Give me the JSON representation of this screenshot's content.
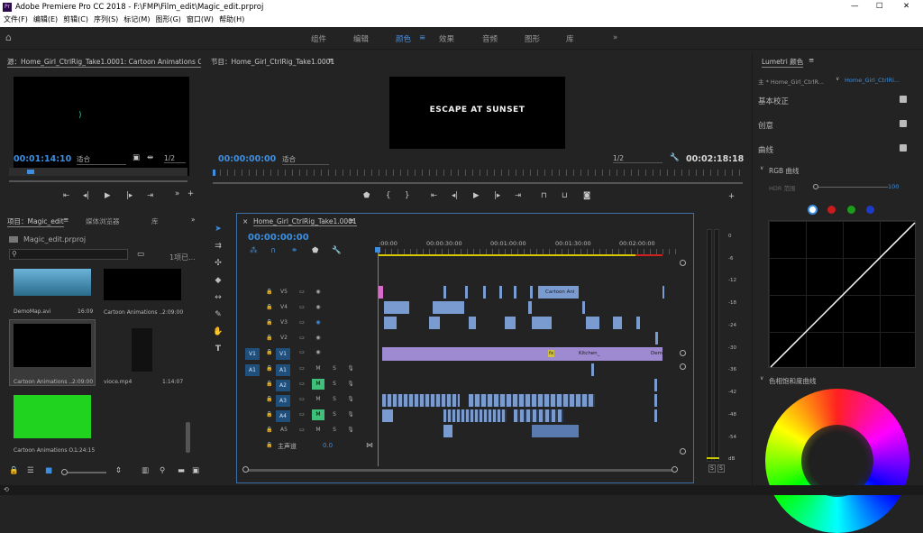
{
  "window": {
    "title": "Adobe Premiere Pro CC 2018 - F:\\FMP\\Film_edit\\Magic_edit.prproj",
    "minimize": "—",
    "maximize": "☐",
    "close": "✕"
  },
  "menu": [
    "文件(F)",
    "编辑(E)",
    "剪辑(C)",
    "序列(S)",
    "标记(M)",
    "图形(G)",
    "窗口(W)",
    "帮助(H)"
  ],
  "workspaces": {
    "items": [
      "组件",
      "编辑",
      "颜色",
      "效果",
      "音频",
      "图形",
      "库"
    ],
    "active": "颜色",
    "more": "»",
    "home": "⌂"
  },
  "source": {
    "title": "源：Home_Girl_CtrlRig_Take1.0001: Cartoon Animations O",
    "timecode": "00:01:14:10",
    "fit": "适合",
    "ratio": "1/2"
  },
  "program": {
    "title": "节目：Home_Girl_CtrlRig_Take1.0001",
    "video_text": "ESCAPE AT SUNSET",
    "timecode": "00:00:00:00",
    "fit": "适合",
    "ratio": "1/2",
    "duration": "00:02:18:18"
  },
  "project": {
    "title": "项目：Magic_edit",
    "tab_media": "媒体浏览器",
    "tab_lib": "库",
    "file": "Magic_edit.prproj",
    "count": "1项已...",
    "search_placeholder": "",
    "items": [
      {
        "name": "DemoMap.avi",
        "dur": "16:09",
        "thumb": "#4a8fb8"
      },
      {
        "name": "Cartoon Animations ...",
        "dur": "2:09:00",
        "thumb": "#000000"
      },
      {
        "name": "Cartoon Animations ...",
        "dur": "2:09:00",
        "thumb": "#000000"
      },
      {
        "name": "vioce.mp4",
        "dur": "1:14:07",
        "thumb": "#000000"
      },
      {
        "name": "Cartoon Animations O...",
        "dur": "1:24:15",
        "thumb": "#1fd31f"
      }
    ]
  },
  "timeline": {
    "title": "Home_Girl_CtrlRig_Take1.0001",
    "timecode": "00:00:00:00",
    "ruler": [
      ":00:00",
      "00:00:30:00",
      "00:01:00:00",
      "00:01:30:00",
      "00:02:00:00"
    ],
    "tracks": [
      "V5",
      "V4",
      "V3",
      "V2",
      "V1",
      "A1",
      "A2",
      "A3",
      "A4",
      "A5"
    ],
    "master": "主声道",
    "master_val": "0.0",
    "clip_cartoon": "Cartoon Ani",
    "clip_kitchen": "Kitchen_",
    "clip_dem": "Dem",
    "fx": "fx",
    "v1_target": "V1",
    "a1_target": "A1",
    "mute": "M",
    "solo": "S"
  },
  "meter": {
    "scale": [
      "0",
      "-6",
      "-12",
      "-18",
      "-24",
      "-30",
      "-36",
      "-42",
      "-48",
      "-54",
      "dB"
    ],
    "solo": "S"
  },
  "lumetri": {
    "title": "Lumetri 颜色",
    "tab_master": "主 * Home_Girl_CtrlR...",
    "tab_seq": "Home_Girl_CtrlRi...",
    "basic": "基本校正",
    "creative": "创意",
    "curves": "曲线",
    "rgb": "RGB 曲线",
    "hdr": "HDR 范围",
    "hdr_val": "100",
    "huesat": "色相饱和度曲线",
    "colors": {
      "white": "#ffffff",
      "red": "#c81c1c",
      "green": "#1c9c1c",
      "blue": "#1c3cc8"
    }
  }
}
